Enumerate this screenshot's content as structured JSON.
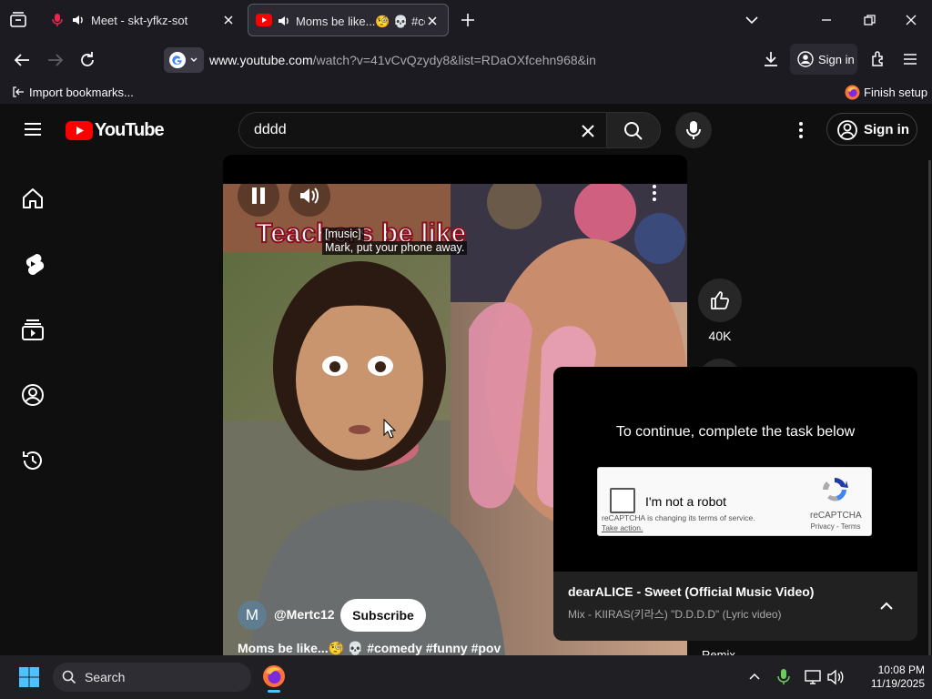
{
  "browser": {
    "tabs": [
      {
        "title": "Meet - skt-yfkz-sot",
        "active": false
      },
      {
        "title": "Moms be like...🧐 💀 #com",
        "active": true
      }
    ],
    "url": {
      "domain": "www.youtube.com",
      "path": "/watch?v=41vCvQzydy8&list=RDaOXfcehn968&in"
    },
    "sign_in_label": "Sign in",
    "bookmarks": {
      "import_label": "Import bookmarks...",
      "finish_setup_label": "Finish setup"
    }
  },
  "youtube": {
    "logo_text": "YouTube",
    "search_query": "dddd",
    "sign_in_label": "Sign in",
    "sidebar": [
      "home-icon",
      "shorts-icon",
      "subscriptions-icon",
      "you-icon",
      "history-icon"
    ],
    "video": {
      "overlay_title": "Teachers be like",
      "caption_line1": "[music]",
      "caption_line2": "Mark, put your phone away.",
      "channel_avatar_letter": "M",
      "channel_name": "@Mertc12",
      "subscribe_label": "Subscribe",
      "title": "Moms be like...🧐 💀 #comedy #funny #pov"
    },
    "actions": {
      "like_count": "40K",
      "remix_label": "Remix"
    },
    "captcha": {
      "heading": "To continue, complete the task below",
      "checkbox_label": "I'm not a robot",
      "brand": "reCAPTCHA",
      "notice": "reCAPTCHA is changing its terms of service.",
      "take_action": "Take action.",
      "privacy": "Privacy",
      "terms": "Terms",
      "separator": " - "
    },
    "mix": {
      "title": "dearALICE - Sweet (Official Music Video)",
      "subtitle": "Mix - KIIRAS(키라스) \"D.D.D.D\" (Lyric video)"
    }
  },
  "taskbar": {
    "search_label": "Search",
    "time": "10:08 PM",
    "date": "11/19/2025"
  },
  "colors": {
    "yt_red": "#ff0000",
    "accent_blue": "#0078d4",
    "firefox_orange": "#ff7139"
  }
}
